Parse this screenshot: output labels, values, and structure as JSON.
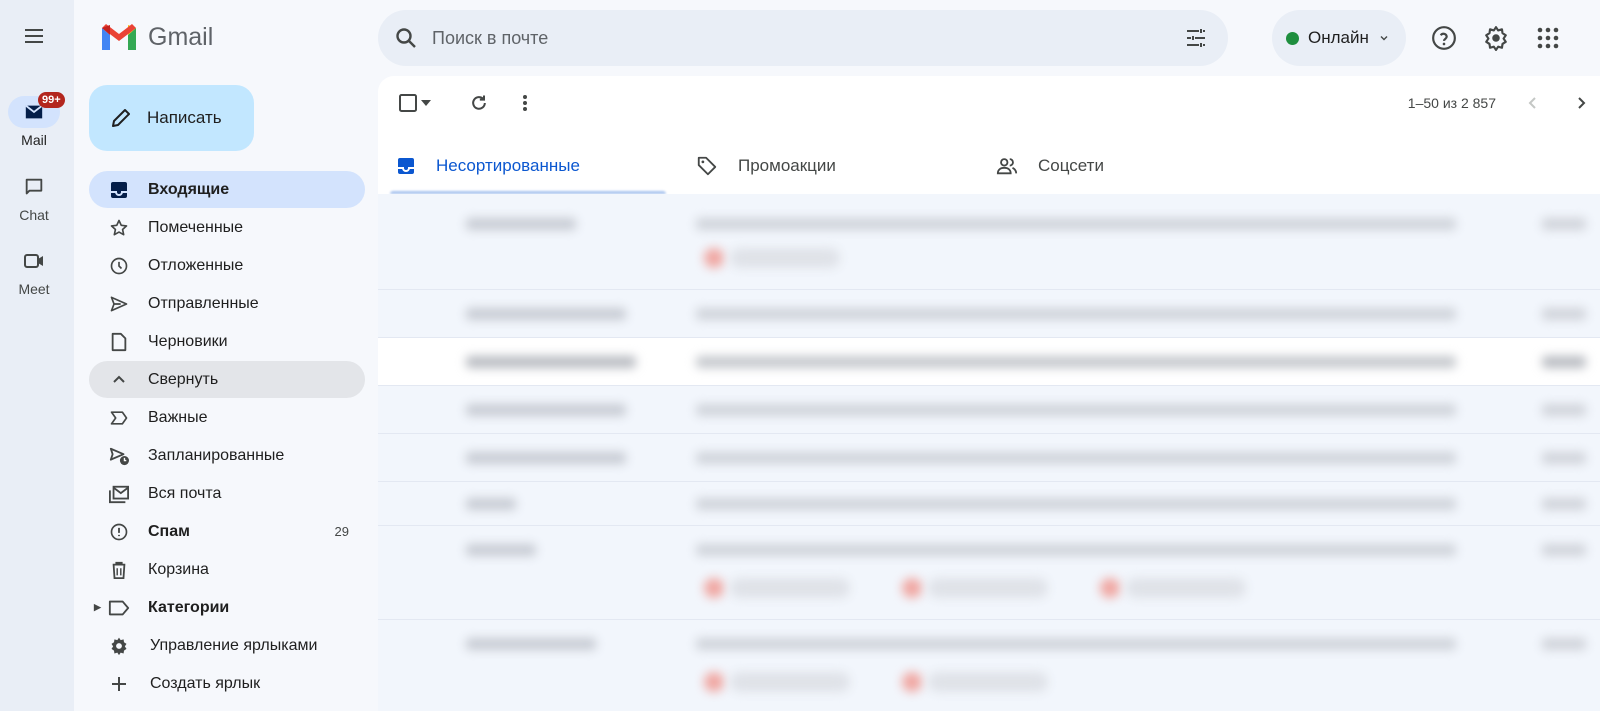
{
  "app": {
    "name": "Gmail"
  },
  "rail": {
    "menu_icon": "hamburger-menu-icon",
    "items": [
      {
        "label": "Mail",
        "icon": "mail-icon",
        "badge": "99+",
        "active": true
      },
      {
        "label": "Chat",
        "icon": "chat-icon"
      },
      {
        "label": "Meet",
        "icon": "video-camera-icon"
      }
    ]
  },
  "compose": {
    "label": "Написать",
    "icon": "pencil-icon"
  },
  "nav": {
    "items": [
      {
        "label": "Входящие",
        "icon": "inbox-icon",
        "active": true
      },
      {
        "label": "Помеченные",
        "icon": "star-icon"
      },
      {
        "label": "Отложенные",
        "icon": "clock-icon"
      },
      {
        "label": "Отправленные",
        "icon": "send-icon"
      },
      {
        "label": "Черновики",
        "icon": "draft-icon"
      },
      {
        "label": "Свернуть",
        "icon": "chevron-up-icon"
      },
      {
        "label": "Важные",
        "icon": "important-icon"
      },
      {
        "label": "Запланированные",
        "icon": "scheduled-send-icon"
      },
      {
        "label": "Вся почта",
        "icon": "all-mail-icon"
      },
      {
        "label": "Спам",
        "icon": "spam-icon",
        "count": "29"
      },
      {
        "label": "Корзина",
        "icon": "trash-icon"
      },
      {
        "label": "Категории",
        "icon": "label-icon"
      },
      {
        "label": "Управление ярлыками",
        "icon": "gear-icon"
      },
      {
        "label": "Создать ярлык",
        "icon": "plus-icon"
      }
    ]
  },
  "search": {
    "placeholder": "Поиск в почте",
    "value": ""
  },
  "status": {
    "label": "Онлайн",
    "color": "#1e8e3e"
  },
  "toolbar": {
    "pager": "1–50 из 2 857"
  },
  "tabs": [
    {
      "label": "Несортированные",
      "icon": "inbox-icon",
      "active": true
    },
    {
      "label": "Промоакции",
      "icon": "tag-icon"
    },
    {
      "label": "Соцсети",
      "icon": "people-icon"
    }
  ],
  "colors": {
    "accent": "#0b57d0",
    "compose_bg": "#c2e7ff",
    "active_nav_bg": "#d3e3fd",
    "badge": "#b3261e"
  },
  "message_list": {
    "note": "contents blurred"
  }
}
